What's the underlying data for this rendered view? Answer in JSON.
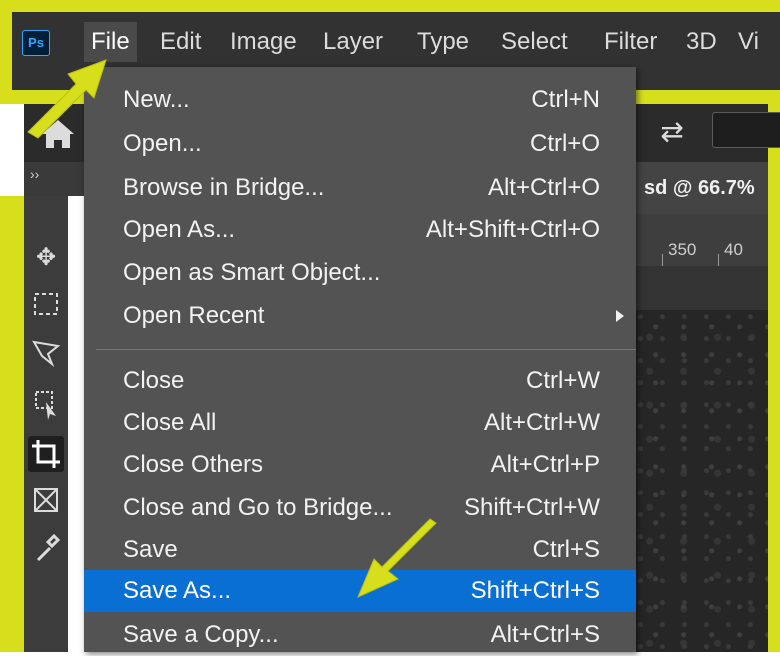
{
  "app": {
    "logo": "Ps"
  },
  "menubar": {
    "items": [
      "File",
      "Edit",
      "Image",
      "Layer",
      "Type",
      "Select",
      "Filter",
      "3D",
      "Vi"
    ],
    "active": "File"
  },
  "document": {
    "tab_title": "sd @ 66.7%",
    "ruler_marks": [
      "350",
      "40"
    ]
  },
  "file_menu": {
    "items": [
      {
        "label": "New...",
        "shortcut": "Ctrl+N"
      },
      {
        "label": "Open...",
        "shortcut": "Ctrl+O"
      },
      {
        "label": "Browse in Bridge...",
        "shortcut": "Alt+Ctrl+O"
      },
      {
        "label": "Open As...",
        "shortcut": "Alt+Shift+Ctrl+O"
      },
      {
        "label": "Open as Smart Object...",
        "shortcut": ""
      },
      {
        "label": "Open Recent",
        "shortcut": ""
      },
      {
        "label": "Close",
        "shortcut": "Ctrl+W"
      },
      {
        "label": "Close All",
        "shortcut": "Alt+Ctrl+W"
      },
      {
        "label": "Close Others",
        "shortcut": "Alt+Ctrl+P"
      },
      {
        "label": "Close and Go to Bridge...",
        "shortcut": "Shift+Ctrl+W"
      },
      {
        "label": "Save",
        "shortcut": "Ctrl+S"
      },
      {
        "label": "Save As...",
        "shortcut": "Shift+Ctrl+S"
      },
      {
        "label": "Save a Copy...",
        "shortcut": "Alt+Ctrl+S"
      }
    ],
    "highlighted": "Save As..."
  },
  "tools": [
    "move-tool",
    "marquee-tool",
    "lasso-tool",
    "object-selection-tool",
    "crop-tool",
    "frame-tool",
    "eyedropper-tool"
  ],
  "colors": {
    "highlight": "#0a6fd2",
    "annotation_arrow": "#d7de1c",
    "menu_bg": "#535353"
  }
}
